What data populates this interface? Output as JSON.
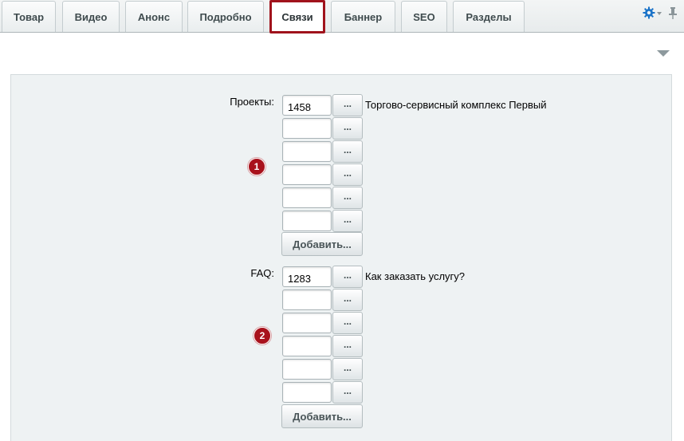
{
  "tabs": [
    {
      "label": "Товар",
      "active": false
    },
    {
      "label": "Видео",
      "active": false
    },
    {
      "label": "Анонс",
      "active": false
    },
    {
      "label": "Подробно",
      "active": false
    },
    {
      "label": "Связи",
      "active": true
    },
    {
      "label": "Баннер",
      "active": false
    },
    {
      "label": "SEO",
      "active": false
    },
    {
      "label": "Разделы",
      "active": false
    }
  ],
  "toolbar": {
    "settings_icon": "gear-icon",
    "pin_icon": "pin-icon",
    "collapse_icon": "triangle-down-icon"
  },
  "sections": [
    {
      "label": "Проекты:",
      "badge": "1",
      "rows": [
        {
          "value": "1458",
          "button": "...",
          "linked": "Торгово-сервисный комплекс Первый"
        },
        {
          "value": "",
          "button": "...",
          "linked": ""
        },
        {
          "value": "",
          "button": "...",
          "linked": ""
        },
        {
          "value": "",
          "button": "...",
          "linked": ""
        },
        {
          "value": "",
          "button": "...",
          "linked": ""
        },
        {
          "value": "",
          "button": "...",
          "linked": ""
        }
      ],
      "add_label": "Добавить..."
    },
    {
      "label": "FAQ:",
      "badge": "2",
      "rows": [
        {
          "value": "1283",
          "button": "...",
          "linked": "Как заказать услугу?"
        },
        {
          "value": "",
          "button": "...",
          "linked": ""
        },
        {
          "value": "",
          "button": "...",
          "linked": ""
        },
        {
          "value": "",
          "button": "...",
          "linked": ""
        },
        {
          "value": "",
          "button": "...",
          "linked": ""
        },
        {
          "value": "",
          "button": "...",
          "linked": ""
        }
      ],
      "add_label": "Добавить..."
    }
  ],
  "colors": {
    "accent": "#a0131c",
    "badge": "#a8121c",
    "settings_icon": "#1a73c8"
  }
}
